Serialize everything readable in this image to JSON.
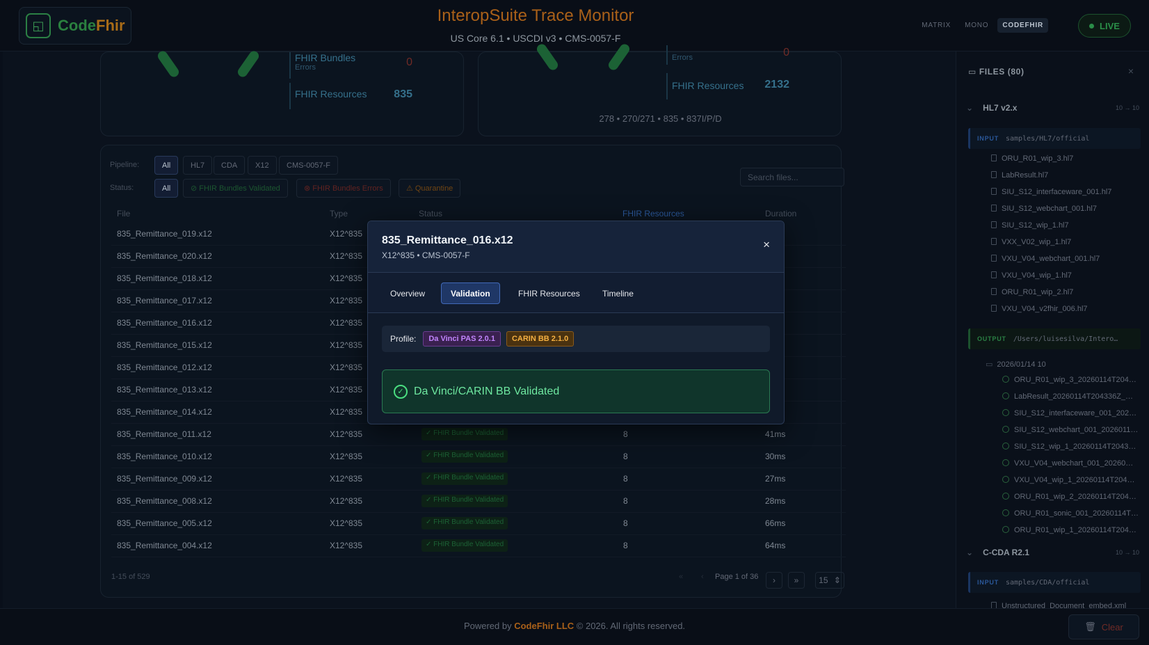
{
  "header": {
    "logo_main": "Code",
    "logo_accent": "Fhir",
    "title": "InteropSuite Trace Monitor",
    "subtitle": "US Core 6.1 • USCDI v3 • CMS-0057-F",
    "themes": [
      "MATRIX",
      "MONO",
      "CODEFHIR"
    ],
    "active_theme": "CODEFHIR",
    "live_label": "LIVE"
  },
  "stats_left": {
    "bundles_label": "FHIR Bundles",
    "bundles_sub": "Errors",
    "bundles_value": "0",
    "resources_label": "FHIR Resources",
    "resources_value": "835"
  },
  "stats_right": {
    "bundles_sub": "Errors",
    "bundles_value": "0",
    "resources_label": "FHIR Resources",
    "resources_value": "2132",
    "footnote": "278 • 270/271 • 835 • 837I/P/D"
  },
  "filters": {
    "pipeline_label": "Pipeline:",
    "pipeline": [
      "All",
      "HL7",
      "CDA",
      "X12",
      "CMS-0057-F"
    ],
    "status_label": "Status:",
    "status": [
      "All",
      "FHIR Bundles Validated",
      "FHIR Bundles Errors",
      "Quarantine"
    ],
    "search_placeholder": "Search files..."
  },
  "table": {
    "headers": [
      "File",
      "Type",
      "Status",
      "FHIR Resources",
      "Duration"
    ],
    "rows": [
      {
        "file": "835_Remittance_019.x12",
        "type": "X12^835",
        "status": "",
        "res": "",
        "dur": ""
      },
      {
        "file": "835_Remittance_020.x12",
        "type": "X12^835",
        "status": "",
        "res": "",
        "dur": ""
      },
      {
        "file": "835_Remittance_018.x12",
        "type": "X12^835",
        "status": "",
        "res": "",
        "dur": ""
      },
      {
        "file": "835_Remittance_017.x12",
        "type": "X12^835",
        "status": "",
        "res": "",
        "dur": ""
      },
      {
        "file": "835_Remittance_016.x12",
        "type": "X12^835",
        "status": "",
        "res": "",
        "dur": ""
      },
      {
        "file": "835_Remittance_015.x12",
        "type": "X12^835",
        "status": "",
        "res": "",
        "dur": ""
      },
      {
        "file": "835_Remittance_012.x12",
        "type": "X12^835",
        "status": "",
        "res": "",
        "dur": ""
      },
      {
        "file": "835_Remittance_013.x12",
        "type": "X12^835",
        "status": "",
        "res": "",
        "dur": ""
      },
      {
        "file": "835_Remittance_014.x12",
        "type": "X12^835",
        "status": "",
        "res": "",
        "dur": ""
      },
      {
        "file": "835_Remittance_011.x12",
        "type": "X12^835",
        "status": "✓ FHIR Bundle Validated",
        "res": "8",
        "dur": "41ms"
      },
      {
        "file": "835_Remittance_010.x12",
        "type": "X12^835",
        "status": "✓ FHIR Bundle Validated",
        "res": "8",
        "dur": "30ms"
      },
      {
        "file": "835_Remittance_009.x12",
        "type": "X12^835",
        "status": "✓ FHIR Bundle Validated",
        "res": "8",
        "dur": "27ms"
      },
      {
        "file": "835_Remittance_008.x12",
        "type": "X12^835",
        "status": "✓ FHIR Bundle Validated",
        "res": "8",
        "dur": "28ms"
      },
      {
        "file": "835_Remittance_005.x12",
        "type": "X12^835",
        "status": "✓ FHIR Bundle Validated",
        "res": "8",
        "dur": "66ms"
      },
      {
        "file": "835_Remittance_004.x12",
        "type": "X12^835",
        "status": "✓ FHIR Bundle Validated",
        "res": "8",
        "dur": "64ms"
      }
    ],
    "range": "1-15 of 529",
    "page": "Page 1 of 36",
    "next": "›",
    "last": "»",
    "first": "«",
    "prev": "‹",
    "page_size": "15"
  },
  "sidebar": {
    "title": "FILES  (80)",
    "close": "×",
    "groups": [
      {
        "name": "HL7 v2.x",
        "count": "10 → 10"
      },
      {
        "name": "C-CDA R2.1",
        "count": "10 → 10"
      }
    ],
    "hl7_input_tag": "INPUT",
    "hl7_input_path": "samples/HL7/official",
    "hl7_files": [
      "ORU_R01_wip_3.hl7",
      "LabResult.hl7",
      "SIU_S12_interfaceware_001.hl7",
      "SIU_S12_webchart_001.hl7",
      "SIU_S12_wip_1.hl7",
      "VXX_V02_wip_1.hl7",
      "VXU_V04_webchart_001.hl7",
      "VXU_V04_wip_1.hl7",
      "ORU_R01_wip_2.hl7",
      "VXU_V04_v2fhir_006.hl7"
    ],
    "output_tag": "OUTPUT",
    "output_path": "/Users/luisesilva/Intero…",
    "output_folder": "2026/01/14  10",
    "output_files": [
      "ORU_R01_wip_3_20260114T204…",
      "LabResult_20260114T204336Z_…",
      "SIU_S12_interfaceware_001_202…",
      "SIU_S12_webchart_001_2026011…",
      "SIU_S12_wip_1_20260114T2043…",
      "VXU_V04_webchart_001_20260…",
      "VXU_V04_wip_1_20260114T204…",
      "ORU_R01_wip_2_20260114T204…",
      "ORU_R01_sonic_001_20260114T…",
      "ORU_R01_wip_1_20260114T204…"
    ],
    "cda_input_tag": "INPUT",
    "cda_input_path": "samples/CDA/official",
    "cda_first_file": "Unstructured_Document_embed.xml"
  },
  "footer": {
    "prefix": "Powered by ",
    "company": "CodeFhir LLC",
    "suffix": " © 2026. All rights reserved.",
    "clear_label": "Clear"
  },
  "modal": {
    "title": "835_Remittance_016.x12",
    "subtitle": "X12^835 • CMS-0057-F",
    "close": "×",
    "tabs": [
      "Overview",
      "Validation",
      "FHIR Resources",
      "Timeline"
    ],
    "active_tab": "Validation",
    "profile_label": "Profile:",
    "profiles": [
      "Da Vinci PAS 2.0.1",
      "CARIN BB 2.1.0"
    ],
    "validated_text": "Da Vinci/CARIN BB Validated"
  }
}
